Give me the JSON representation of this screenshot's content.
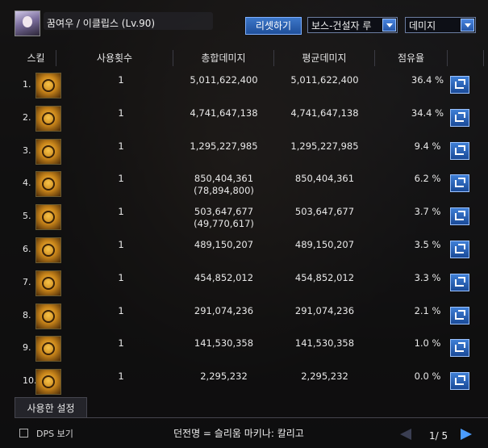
{
  "window": {
    "character_title": "꿈여우 / 이클립스 (Lv.90)",
    "reset_button": "리셋하기",
    "target_select": "보스-건설자 루",
    "metric_select": "데미지"
  },
  "table": {
    "headers": [
      "스킬",
      "사용횟수",
      "총합데미지",
      "평균데미지",
      "점유율"
    ],
    "rows": [
      {
        "idx": "1.",
        "uses": "1",
        "total": "5,011,622,400",
        "total_sub": "",
        "avg": "5,011,622,400",
        "share": "36.4 %",
        "icon": "skill-icon-1"
      },
      {
        "idx": "2.",
        "uses": "1",
        "total": "4,741,647,138",
        "total_sub": "",
        "avg": "4,741,647,138",
        "share": "34.4 %",
        "icon": "skill-icon-2"
      },
      {
        "idx": "3.",
        "uses": "1",
        "total": "1,295,227,985",
        "total_sub": "",
        "avg": "1,295,227,985",
        "share": "9.4 %",
        "icon": "skill-icon-3"
      },
      {
        "idx": "4.",
        "uses": "1",
        "total": "850,404,361",
        "total_sub": "(78,894,800)",
        "avg": "850,404,361",
        "share": "6.2 %",
        "icon": "skill-icon-4"
      },
      {
        "idx": "5.",
        "uses": "1",
        "total": "503,647,677",
        "total_sub": "(49,770,617)",
        "avg": "503,647,677",
        "share": "3.7 %",
        "icon": "skill-icon-5"
      },
      {
        "idx": "6.",
        "uses": "1",
        "total": "489,150,207",
        "total_sub": "",
        "avg": "489,150,207",
        "share": "3.5 %",
        "icon": "skill-icon-6"
      },
      {
        "idx": "7.",
        "uses": "1",
        "total": "454,852,012",
        "total_sub": "",
        "avg": "454,852,012",
        "share": "3.3 %",
        "icon": "skill-icon-7"
      },
      {
        "idx": "8.",
        "uses": "1",
        "total": "291,074,236",
        "total_sub": "",
        "avg": "291,074,236",
        "share": "2.1 %",
        "icon": "skill-icon-8"
      },
      {
        "idx": "9.",
        "uses": "1",
        "total": "141,530,358",
        "total_sub": "",
        "avg": "141,530,358",
        "share": "1.0 %",
        "icon": "skill-icon-9"
      },
      {
        "idx": "10.",
        "uses": "1",
        "total": "2,295,232",
        "total_sub": "",
        "avg": "2,295,232",
        "share": "0.0 %",
        "icon": "skill-icon-10"
      }
    ]
  },
  "footer": {
    "settings_tab": "사용한 설정",
    "dps_label": "DPS 보기",
    "dungeon_text": "던전명 = 슬리움 마키나: 칼리고",
    "page": "1/ 5"
  }
}
